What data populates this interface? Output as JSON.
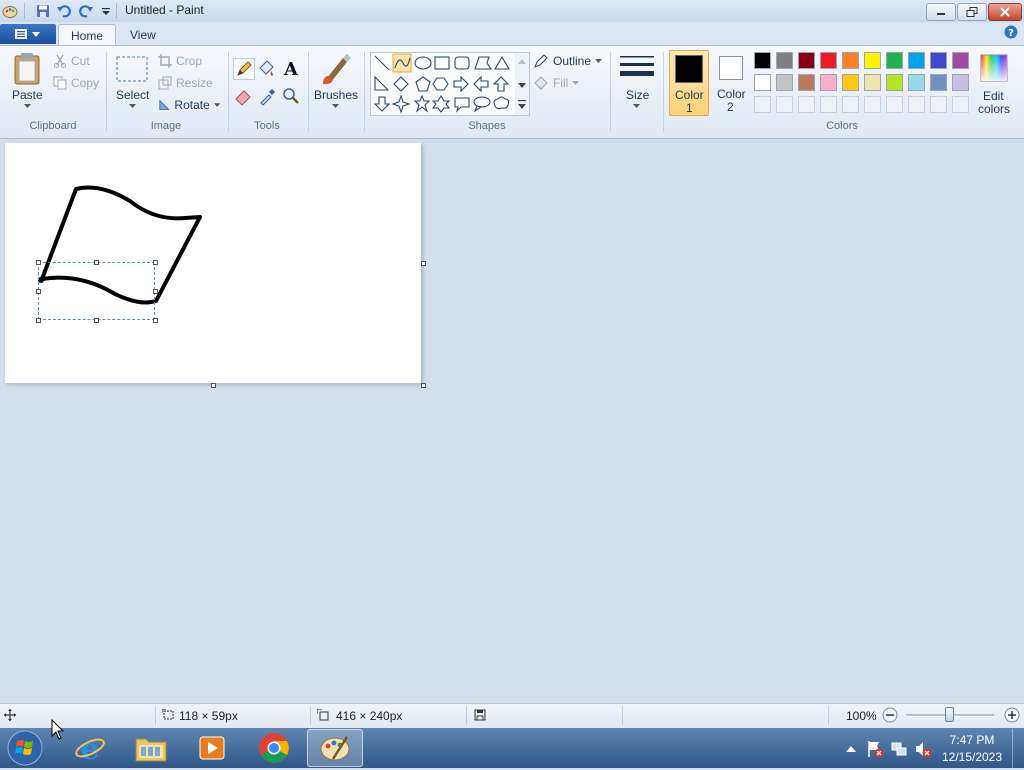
{
  "window": {
    "title": "Untitled - Paint"
  },
  "tabs": [
    {
      "label": "Home"
    },
    {
      "label": "View"
    }
  ],
  "ribbon": {
    "clipboard": {
      "paste": "Paste",
      "cut": "Cut",
      "copy": "Copy",
      "group": "Clipboard"
    },
    "image": {
      "select": "Select",
      "crop": "Crop",
      "resize": "Resize",
      "rotate": "Rotate",
      "group": "Image"
    },
    "tools": {
      "group": "Tools"
    },
    "brushes": {
      "label": "Brushes"
    },
    "shapes": {
      "outline": "Outline",
      "fill": "Fill",
      "group": "Shapes"
    },
    "size": {
      "label": "Size"
    },
    "color1": {
      "line1": "Color",
      "line2": "1",
      "value": "#000000"
    },
    "color2": {
      "line1": "Color",
      "line2": "2",
      "value": "#ffffff"
    },
    "colors": {
      "group": "Colors",
      "row1": [
        "#000000",
        "#7f7f7f",
        "#880015",
        "#ed1c24",
        "#ff7f27",
        "#fff200",
        "#22b14c",
        "#00a2e8",
        "#3f48cc",
        "#a349a4"
      ],
      "row2": [
        "#ffffff",
        "#c3c3c3",
        "#b97a57",
        "#ffaec9",
        "#ffc90e",
        "#efe4b0",
        "#b5e61d",
        "#99d9ea",
        "#7092be",
        "#c8bfe7"
      ]
    },
    "edit_colors": {
      "line1": "Edit",
      "line2": "colors"
    }
  },
  "statusbar": {
    "selection_size": "118 × 59px",
    "canvas_size": "416 × 240px",
    "zoom": "100%"
  },
  "taskbar": {
    "time": "7:47 PM",
    "date": "12/15/2023"
  }
}
